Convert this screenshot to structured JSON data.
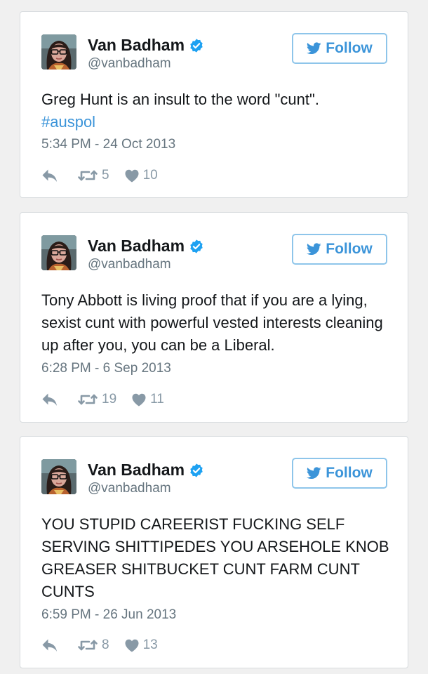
{
  "colors": {
    "accent": "#3b94d9",
    "follow_border": "#8ec5ea",
    "muted": "#66757f",
    "icons": "#8899a6",
    "background": "#f0f0f0"
  },
  "tweets": [
    {
      "user": {
        "name": "Van Badham",
        "handle": "@vanbadham",
        "verified": true
      },
      "follow_label": "Follow",
      "text": "Greg Hunt is an insult to the word \"cunt\".",
      "hashtag": "#auspol",
      "date": "5:34 PM - 24 Oct 2013",
      "retweets": "5",
      "likes": "10"
    },
    {
      "user": {
        "name": "Van Badham",
        "handle": "@vanbadham",
        "verified": true
      },
      "follow_label": "Follow",
      "text": "Tony Abbott is living proof that if you are a lying, sexist cunt with powerful vested interests cleaning up after you, you can be a Liberal.",
      "hashtag": "",
      "date": "6:28 PM - 6 Sep 2013",
      "retweets": "19",
      "likes": "11"
    },
    {
      "user": {
        "name": "Van Badham",
        "handle": "@vanbadham",
        "verified": true
      },
      "follow_label": "Follow",
      "text": "YOU STUPID CAREERIST FUCKING SELF SERVING SHITTIPEDES YOU ARSEHOLE KNOB GREASER SHITBUCKET CUNT FARM CUNT CUNTS",
      "hashtag": "",
      "date": "6:59 PM - 26 Jun 2013",
      "retweets": "8",
      "likes": "13"
    }
  ],
  "icons": [
    "verified-badge-icon",
    "twitter-bird-icon",
    "reply-icon",
    "retweet-icon",
    "heart-icon"
  ]
}
